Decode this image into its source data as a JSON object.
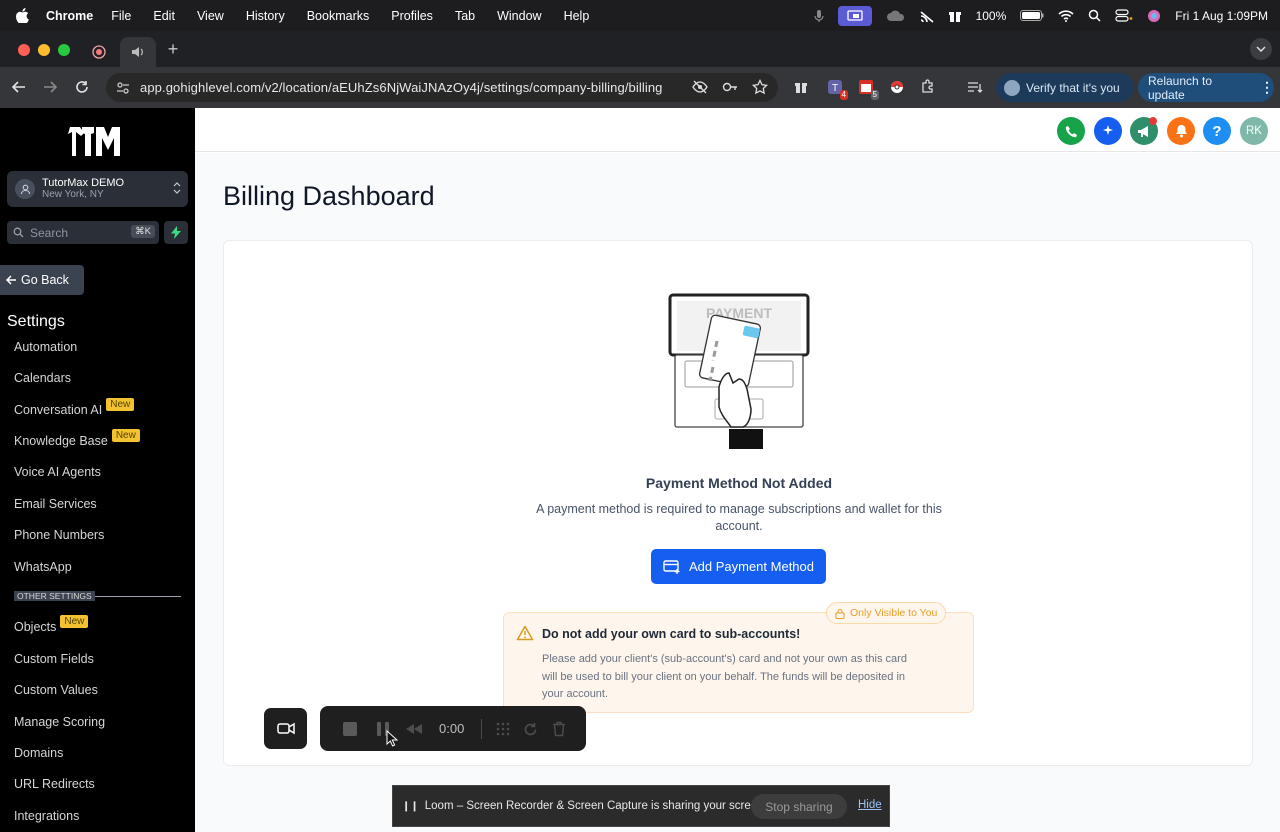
{
  "menubar": {
    "app": "Chrome",
    "items": [
      "File",
      "Edit",
      "View",
      "History",
      "Bookmarks",
      "Profiles",
      "Tab",
      "Window",
      "Help"
    ],
    "battery": "100%",
    "datetime": "Fri 1 Aug  1:09PM"
  },
  "browser": {
    "url": "app.gohighlevel.com/v2/location/aEUhZs6NjWaiJNAzOy4j/settings/company-billing/billing",
    "ext_badge_1": "4",
    "ext_badge_2": "5",
    "verify_label": "Verify that it's you",
    "relaunch_label": "Relaunch to update"
  },
  "sidebar": {
    "account_name": "TutorMax DEMO",
    "account_location": "New York, NY",
    "search_placeholder": "Search",
    "search_shortcut": "⌘K",
    "go_back": "Go Back",
    "settings_title": "Settings",
    "items": [
      {
        "label": "Automation",
        "badge": ""
      },
      {
        "label": "Calendars",
        "badge": ""
      },
      {
        "label": "Conversation AI",
        "badge": "New"
      },
      {
        "label": "Knowledge Base",
        "badge": "New"
      },
      {
        "label": "Voice AI Agents",
        "badge": ""
      },
      {
        "label": "Email Services",
        "badge": ""
      },
      {
        "label": "Phone Numbers",
        "badge": ""
      },
      {
        "label": "WhatsApp",
        "badge": ""
      }
    ],
    "other_settings_label": "OTHER SETTINGS",
    "other_items": [
      {
        "label": "Objects",
        "badge": "New"
      },
      {
        "label": "Custom Fields",
        "badge": ""
      },
      {
        "label": "Custom Values",
        "badge": ""
      },
      {
        "label": "Manage Scoring",
        "badge": ""
      },
      {
        "label": "Domains",
        "badge": ""
      },
      {
        "label": "URL Redirects",
        "badge": ""
      },
      {
        "label": "Integrations",
        "badge": ""
      }
    ]
  },
  "header": {
    "avatar_initials": "RK",
    "help_glyph": "?"
  },
  "main": {
    "page_title": "Billing Dashboard",
    "illustration_text": "PAYMENT",
    "empty_title": "Payment Method Not Added",
    "empty_desc": "A payment method is required to manage subscriptions and wallet for this account.",
    "add_button": "Add Payment Method",
    "warning": {
      "badge": "Only Visible to You",
      "title": "Do not add your own card to sub-accounts!",
      "body": "Please add your client's (sub-account's) card and not your own as this card will be used to bill your client on your behalf. The funds will be deposited in your account."
    }
  },
  "loom": {
    "time": "0:00"
  },
  "sharing": {
    "message": "Loom – Screen Recorder & Screen Capture is sharing your screen.",
    "stop_label": "Stop sharing",
    "hide_label": "Hide"
  }
}
